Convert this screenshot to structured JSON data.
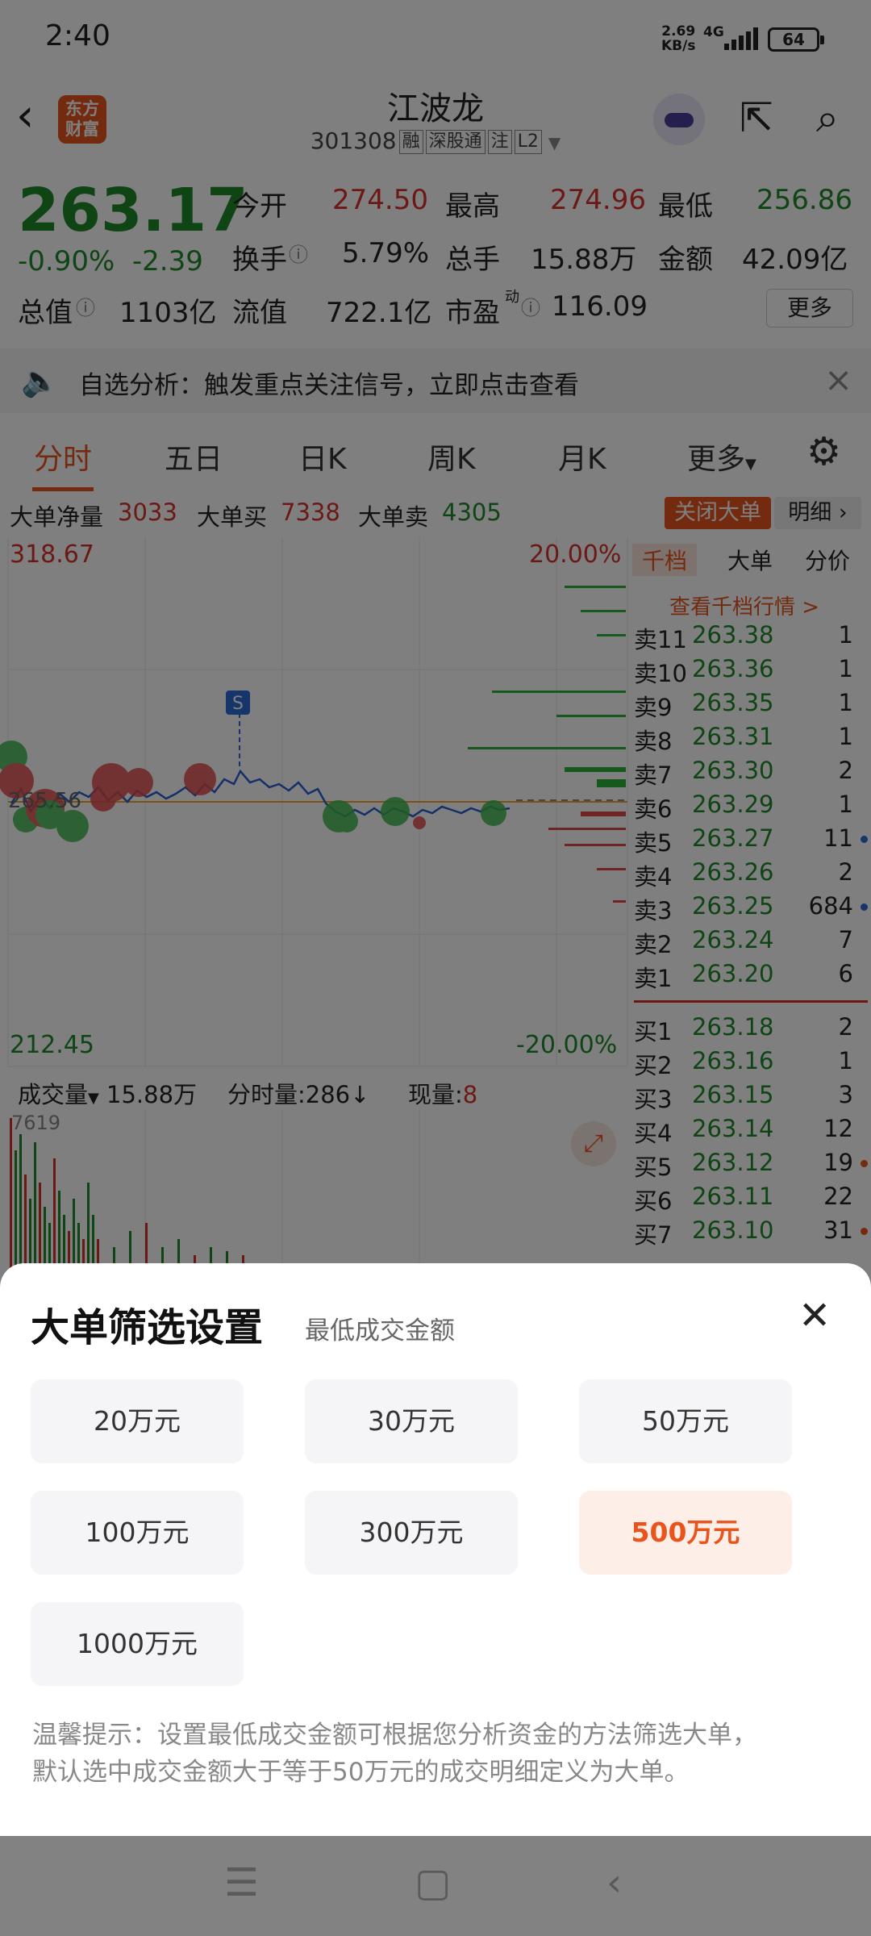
{
  "status": {
    "time": "2:40",
    "speed_top": "2.69",
    "speed_bottom": "KB/s",
    "signal": "4G",
    "battery": "64"
  },
  "header": {
    "logo_line1": "东方",
    "logo_line2": "财富",
    "title": "江波龙",
    "code": "301308",
    "tags": [
      "融",
      "深股通",
      "注",
      "L2"
    ]
  },
  "quote": {
    "price": "263.17",
    "pct": "-0.90%",
    "change": "-2.39",
    "labels": {
      "open": "今开",
      "high": "最高",
      "low": "最低",
      "turnover": "换手",
      "volume": "总手",
      "amount": "金额",
      "mktcap": "总值",
      "float": "流值",
      "pe": "市盈",
      "pe_sup": "动"
    },
    "values": {
      "open": "274.50",
      "high": "274.96",
      "low": "256.86",
      "turnover": "5.79%",
      "volume": "15.88万",
      "amount": "42.09亿",
      "mktcap": "1103亿",
      "float": "722.1亿",
      "pe": "116.09"
    },
    "more": "更多"
  },
  "notice": {
    "text": "自选分析：触发重点关注信号，立即点击查看"
  },
  "tabs": [
    "分时",
    "五日",
    "日K",
    "周K",
    "月K",
    "更多"
  ],
  "orders": {
    "net_label": "大单净量",
    "net": "3033",
    "buy_label": "大单买",
    "buy": "7338",
    "sell_label": "大单卖",
    "sell": "4305",
    "close_btn": "关闭大单",
    "detail_btn": "明细"
  },
  "chart": {
    "top": "318.67",
    "bottom": "212.45",
    "top_pct": "20.00%",
    "bottom_pct": "-20.00%",
    "ref": "265.56",
    "marker": "S"
  },
  "book": {
    "tabs": [
      "千档",
      "大单",
      "分价"
    ],
    "link": "查看千档行情 >",
    "sell": [
      {
        "n": "卖11",
        "p": "263.38",
        "v": "1",
        "dot": ""
      },
      {
        "n": "卖10",
        "p": "263.36",
        "v": "1",
        "dot": ""
      },
      {
        "n": "卖9",
        "p": "263.35",
        "v": "1",
        "dot": ""
      },
      {
        "n": "卖8",
        "p": "263.31",
        "v": "1",
        "dot": ""
      },
      {
        "n": "卖7",
        "p": "263.30",
        "v": "2",
        "dot": ""
      },
      {
        "n": "卖6",
        "p": "263.29",
        "v": "1",
        "dot": ""
      },
      {
        "n": "卖5",
        "p": "263.27",
        "v": "11",
        "dot": "#2a6bd6"
      },
      {
        "n": "卖4",
        "p": "263.26",
        "v": "2",
        "dot": ""
      },
      {
        "n": "卖3",
        "p": "263.25",
        "v": "684",
        "dot": "#2a6bd6"
      },
      {
        "n": "卖2",
        "p": "263.24",
        "v": "7",
        "dot": ""
      },
      {
        "n": "卖1",
        "p": "263.20",
        "v": "6",
        "dot": ""
      }
    ],
    "buy": [
      {
        "n": "买1",
        "p": "263.18",
        "v": "2",
        "dot": ""
      },
      {
        "n": "买2",
        "p": "263.16",
        "v": "1",
        "dot": ""
      },
      {
        "n": "买3",
        "p": "263.15",
        "v": "3",
        "dot": ""
      },
      {
        "n": "买4",
        "p": "263.14",
        "v": "12",
        "dot": ""
      },
      {
        "n": "买5",
        "p": "263.12",
        "v": "19",
        "dot": "#e8541c"
      },
      {
        "n": "买6",
        "p": "263.11",
        "v": "22",
        "dot": ""
      },
      {
        "n": "买7",
        "p": "263.10",
        "v": "31",
        "dot": "#e8541c"
      }
    ]
  },
  "volume": {
    "label": "成交量",
    "value": "15.88万",
    "tick_label": "分时量:",
    "tick": "286",
    "arrow": "↓",
    "now_label": "现量:",
    "now": "8",
    "max": "7619"
  },
  "sheet": {
    "title": "大单筛选设置",
    "subtitle": "最低成交金额",
    "options": [
      "20万元",
      "30万元",
      "50万元",
      "100万元",
      "300万元",
      "500万元",
      "1000万元"
    ],
    "selected": "500万元",
    "tip1": "温馨提示：设置最低成交金额可根据您分析资金的方法筛选大单，",
    "tip2": "默认选中成交金额大于等于50万元的成交明细定义为大单。"
  },
  "colors": {
    "accent": "#e8541c",
    "up": "#d8322c",
    "down": "#1f8a2a"
  }
}
